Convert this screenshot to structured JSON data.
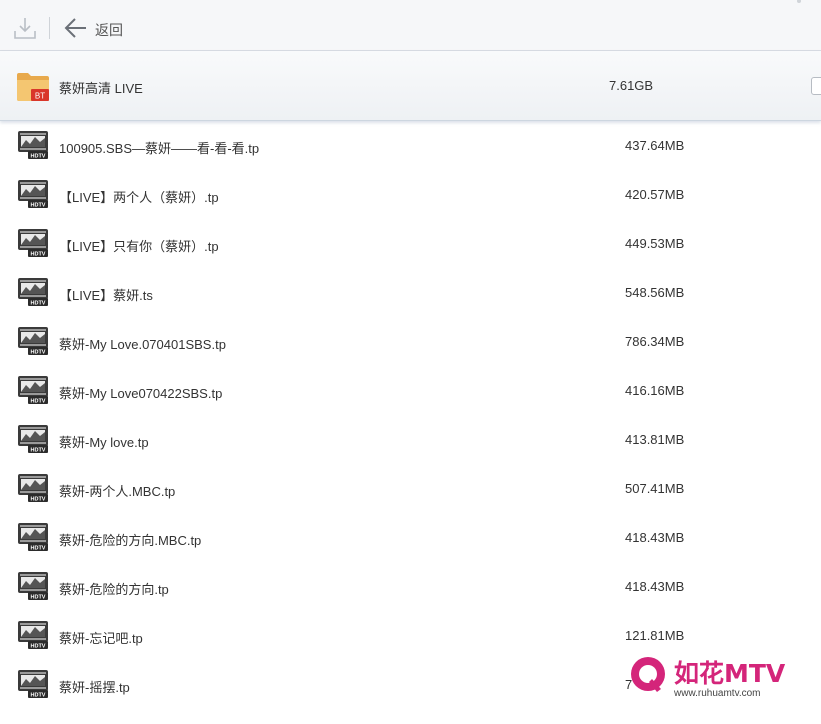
{
  "toolbar": {
    "download_icon": "download-icon",
    "back_icon": "back-arrow-icon",
    "back_label": "返回"
  },
  "folder": {
    "icon": "bt-folder-icon",
    "icon_badge": "BT",
    "name": "蔡妍高清 LIVE",
    "size": "7.61GB"
  },
  "files": [
    {
      "name": "100905.SBS—蔡妍——看-看-看.tp",
      "size": "437.64MB"
    },
    {
      "name": "【LIVE】两个人（蔡妍）.tp",
      "size": "420.57MB"
    },
    {
      "name": "【LIVE】只有你（蔡妍）.tp",
      "size": "449.53MB"
    },
    {
      "name": "【LIVE】蔡妍.ts",
      "size": "548.56MB"
    },
    {
      "name": "蔡妍-My Love.070401SBS.tp",
      "size": "786.34MB"
    },
    {
      "name": "蔡妍-My Love070422SBS.tp",
      "size": "416.16MB"
    },
    {
      "name": "蔡妍-My love.tp",
      "size": "413.81MB"
    },
    {
      "name": "蔡妍-两个人.MBC.tp",
      "size": "507.41MB"
    },
    {
      "name": "蔡妍-危险的方向.MBC.tp",
      "size": "418.43MB"
    },
    {
      "name": "蔡妍-危险的方向.tp",
      "size": "418.43MB"
    },
    {
      "name": "蔡妍-忘记吧.tp",
      "size": "121.81MB"
    },
    {
      "name": "蔡妍-摇摆.tp",
      "size": "7"
    }
  ],
  "file_icon": "hdtv-video-icon",
  "file_icon_label": "HDTV",
  "watermark": {
    "brand": "如花MTV",
    "url": "www.ruhuamtv.com",
    "color": "#d4257a"
  }
}
